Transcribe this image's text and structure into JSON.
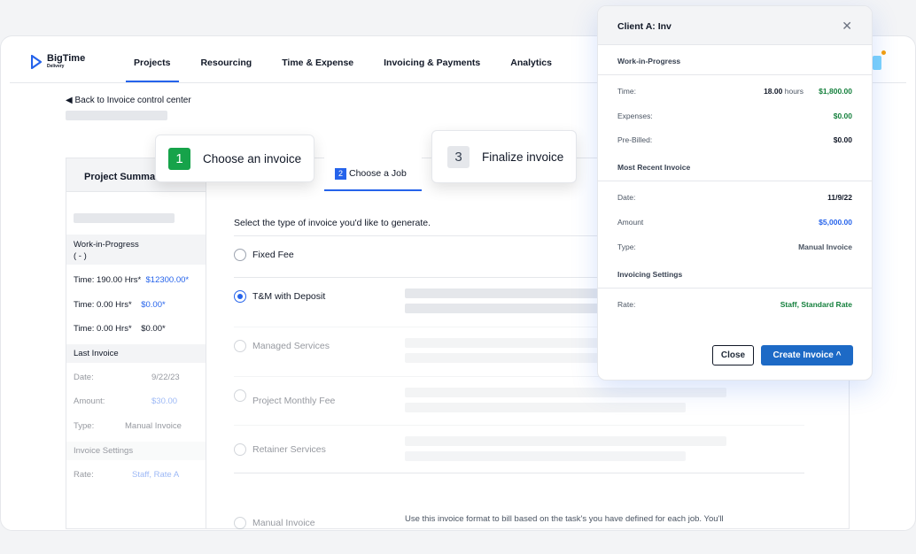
{
  "brand": {
    "name": "BigTime",
    "sub": "Delivery"
  },
  "nav": [
    {
      "label": "Projects",
      "active": true
    },
    {
      "label": "Resourcing"
    },
    {
      "label": "Time & Expense"
    },
    {
      "label": "Invoicing & Payments"
    },
    {
      "label": "Analytics"
    }
  ],
  "back_link": "◀ Back to Invoice control center",
  "steps": {
    "one": {
      "num": "1",
      "label": "Choose an invoice"
    },
    "two": {
      "num": "2",
      "label": "Choose a Job"
    },
    "three": {
      "num": "3",
      "label": "Finalize invoice"
    }
  },
  "sidebar": {
    "heading": "Project Summar",
    "wip": "Work-in-Progress\n( - )",
    "time1": "Time:  190.00 Hrs*",
    "time1_val": "$12300.00*",
    "time2": "Time:   0.00 Hrs*",
    "time2_val": "$0.00*",
    "time3": "Time:   0.00 Hrs*",
    "time3_val": "$0.00*",
    "last_invoice": "Last Invoice",
    "date_label": "Date:",
    "date_val": "9/22/23",
    "amount_label": "Amount:",
    "amount_val": "$30.00",
    "type_label": "Type:",
    "type_val": "Manual Invoice",
    "settings": "Invoice Settings",
    "rate_label": "Rate:",
    "rate_val": "Staff, Rate A"
  },
  "main": {
    "title": "Select the type of invoice you'd like to generate.",
    "options": [
      "Fixed Fee",
      "T&M with Deposit",
      "Managed Services",
      "Project Monthly Fee",
      "Retainer Services",
      "Manual Invoice"
    ],
    "manual_desc": "Use this invoice format to bill based on the task's you have defined for each job. You'll"
  },
  "modal": {
    "title": "Client A: Inv",
    "wip": "Work-in-Progress",
    "time_label": "Time:",
    "time_hours": "18.00",
    "time_unit": "hours",
    "time_amount": "$1,800.00",
    "expenses_label": "Expenses:",
    "expenses_val": "$0.00",
    "prebilled_label": "Pre-Billed:",
    "prebilled_val": "$0.00",
    "recent": "Most Recent Invoice",
    "date_label": "Date:",
    "date_val": "11/9/22",
    "amount_label": "Amount",
    "amount_val": "$5,000.00",
    "type_label": "Type:",
    "type_val": "Manual Invoice",
    "settings": "Invoicing Settings",
    "rate_label": "Rate:",
    "rate_val": "Staff, Standard Rate",
    "close_btn": "Close",
    "create_btn": "Create Invoice ^"
  }
}
